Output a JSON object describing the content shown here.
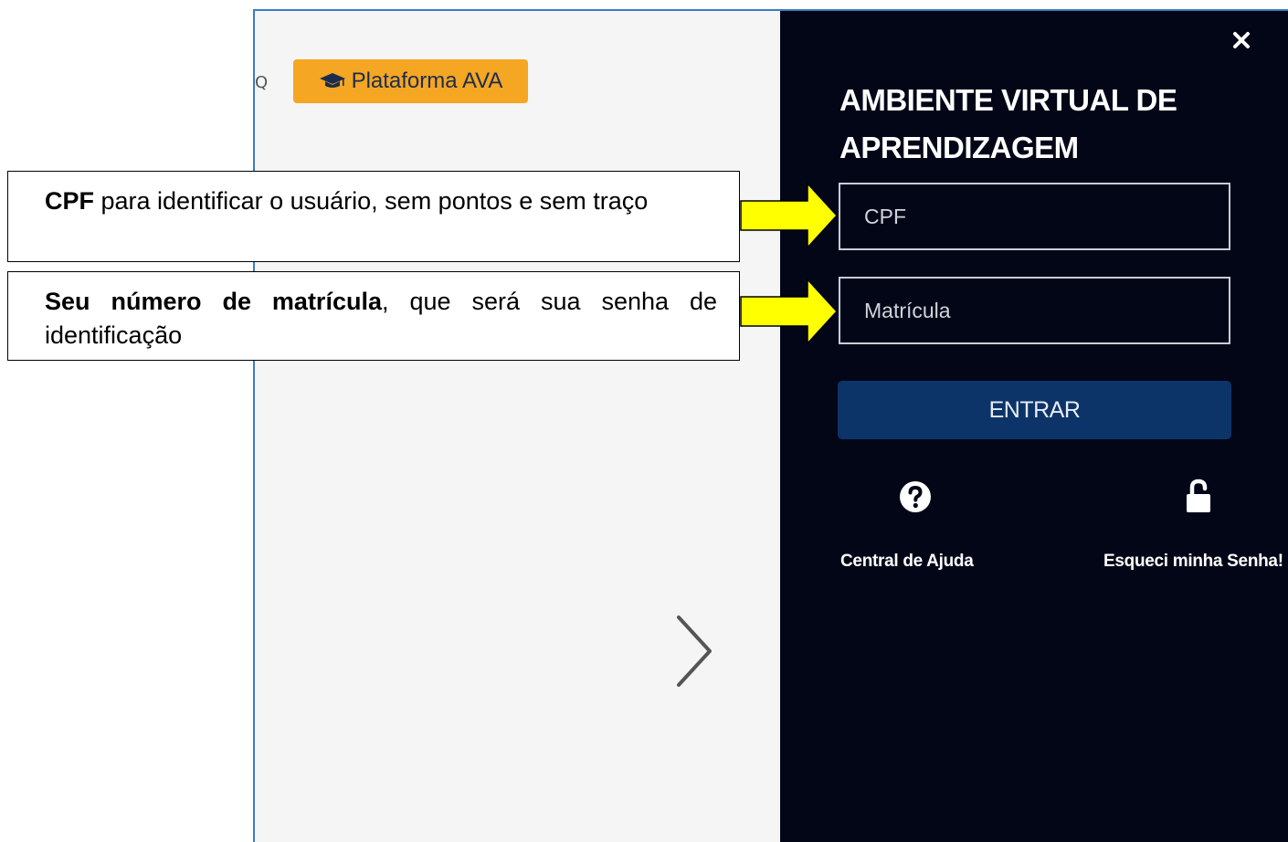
{
  "background": {
    "ava_button_label": "Plataforma AVA",
    "search_fragment": "Q"
  },
  "login_panel": {
    "close_label": "×",
    "title": "AMBIENTE VIRTUAL DE APRENDIZAGEM",
    "cpf_placeholder": "CPF",
    "matricula_placeholder": "Matrícula",
    "enter_label": "ENTRAR",
    "help_label": "Central de Ajuda",
    "forgot_label": "Esqueci minha Senha!"
  },
  "annotations": {
    "cpf": {
      "bold": "CPF",
      "text": " para identificar o usuário, sem pontos e sem traço"
    },
    "matricula": {
      "bold": "Seu número de matrícula",
      "text": ", que será sua senha de identificação"
    }
  },
  "colors": {
    "panel_bg": "#020617",
    "accent_button": "#f5a623",
    "enter_button": "#0c3469",
    "arrow_fill": "#ffff00",
    "frame_border": "#3c7ac8"
  },
  "icons": {
    "ava_button": "graduation-cap-icon",
    "carousel_next": "chevron-right-icon",
    "close": "close-icon",
    "help": "question-circle-icon",
    "forgot": "unlock-icon"
  }
}
